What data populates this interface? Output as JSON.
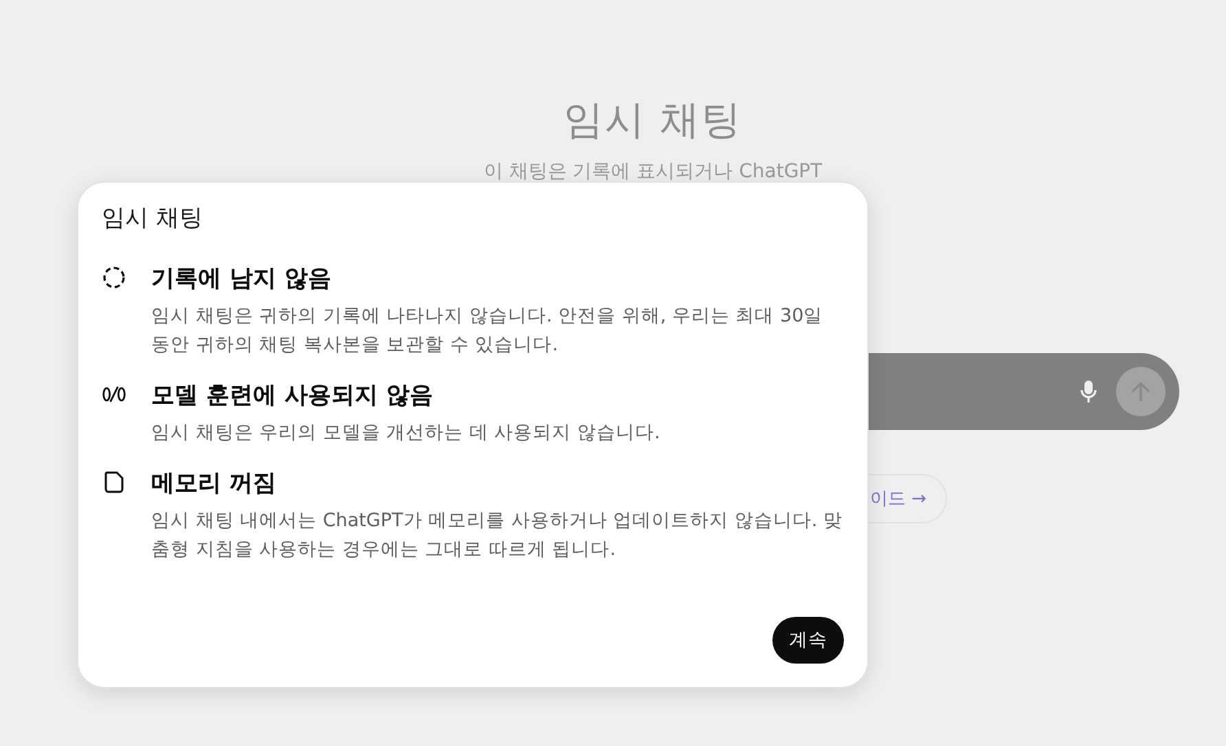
{
  "background": {
    "title": "임시 채팅",
    "subtitle": "이 채팅은 기록에 표시되거나 ChatGPT",
    "suggestion": "이드 →"
  },
  "dialog": {
    "title": "임시 채팅",
    "items": [
      {
        "kind": "history",
        "heading": "기록에 남지 않음",
        "text": "임시 채팅은 귀하의 기록에 나타나지 않습니다. 안전을 위해, 우리는 최대 30일 동안 귀하의 채팅 복사본을 보관할 수 있습니다."
      },
      {
        "kind": "training",
        "heading": "모델 훈련에 사용되지 않음",
        "text": "임시 채팅은 우리의 모델을 개선하는 데 사용되지 않습니다."
      },
      {
        "kind": "memory",
        "heading": "메모리 꺼짐",
        "text": "임시 채팅 내에서는 ChatGPT가 메모리를 사용하거나 업데이트하지 않습니다. 맞춤형 지침을 사용하는 경우에는 그대로 따르게 됩니다."
      }
    ],
    "button": "계속"
  }
}
